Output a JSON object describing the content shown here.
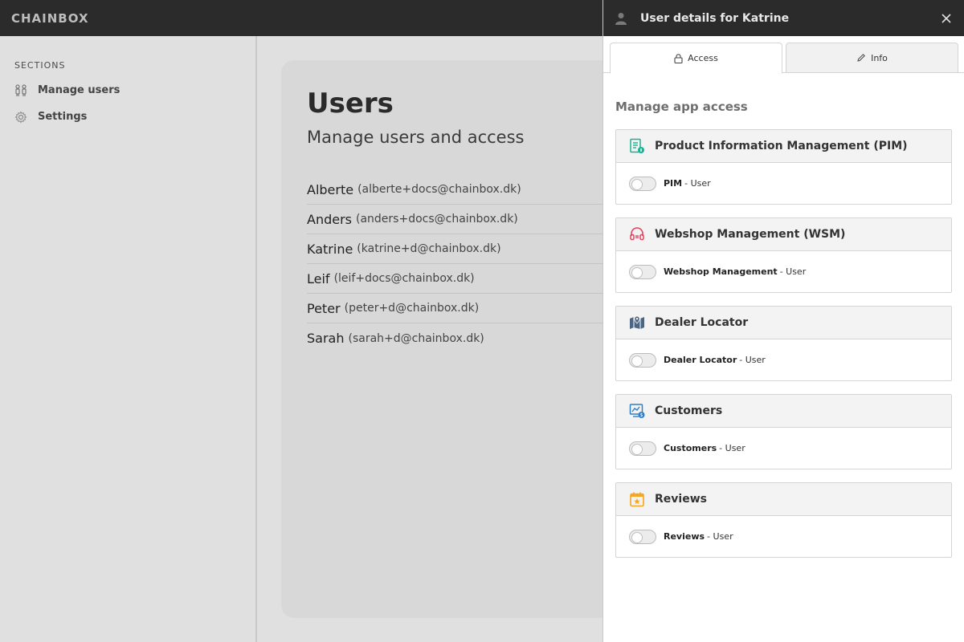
{
  "app": {
    "brand": "CHAINBOX"
  },
  "sidebar": {
    "section_title": "SECTIONS",
    "items": [
      {
        "label": "Manage users",
        "icon": "users-icon"
      },
      {
        "label": "Settings",
        "icon": "gear-icon"
      }
    ]
  },
  "main": {
    "title": "Users",
    "subtitle": "Manage users and access",
    "users": [
      {
        "name": "Alberte",
        "email": "(alberte+docs@chainbox.dk)"
      },
      {
        "name": "Anders",
        "email": "(anders+docs@chainbox.dk)"
      },
      {
        "name": "Katrine",
        "email": "(katrine+d@chainbox.dk)"
      },
      {
        "name": "Leif",
        "email": "(leif+docs@chainbox.dk)"
      },
      {
        "name": "Peter",
        "email": "(peter+d@chainbox.dk)"
      },
      {
        "name": "Sarah",
        "email": "(sarah+d@chainbox.dk)"
      }
    ]
  },
  "drawer": {
    "title": "User details for Katrine",
    "tabs": [
      {
        "label": "Access",
        "icon": "lock-icon",
        "active": true
      },
      {
        "label": "Info",
        "icon": "pencil-icon",
        "active": false
      }
    ],
    "section_heading": "Manage app access",
    "apps": [
      {
        "name": "Product Information Management (PIM)",
        "icon": "pim-document-icon",
        "color": "#19b394",
        "permission": "PIM",
        "role": "- User",
        "enabled": false
      },
      {
        "name": "Webshop Management (WSM)",
        "icon": "headset-icon",
        "color": "#e0455f",
        "permission": "Webshop Management",
        "role": "- User",
        "enabled": false
      },
      {
        "name": "Dealer Locator",
        "icon": "map-marker-icon",
        "color": "#4b6584",
        "permission": "Dealer Locator",
        "role": "- User",
        "enabled": false
      },
      {
        "name": "Customers",
        "icon": "customers-chart-icon",
        "color": "#2f80c8",
        "permission": "Customers",
        "role": "- User",
        "enabled": false
      },
      {
        "name": "Reviews",
        "icon": "calendar-star-icon",
        "color": "#f5a623",
        "permission": "Reviews",
        "role": "- User",
        "enabled": false
      }
    ]
  },
  "colors": {
    "topbar": "#2b2b2b",
    "overlay_background": "#e0e0e0",
    "drawer_background": "#ffffff"
  }
}
